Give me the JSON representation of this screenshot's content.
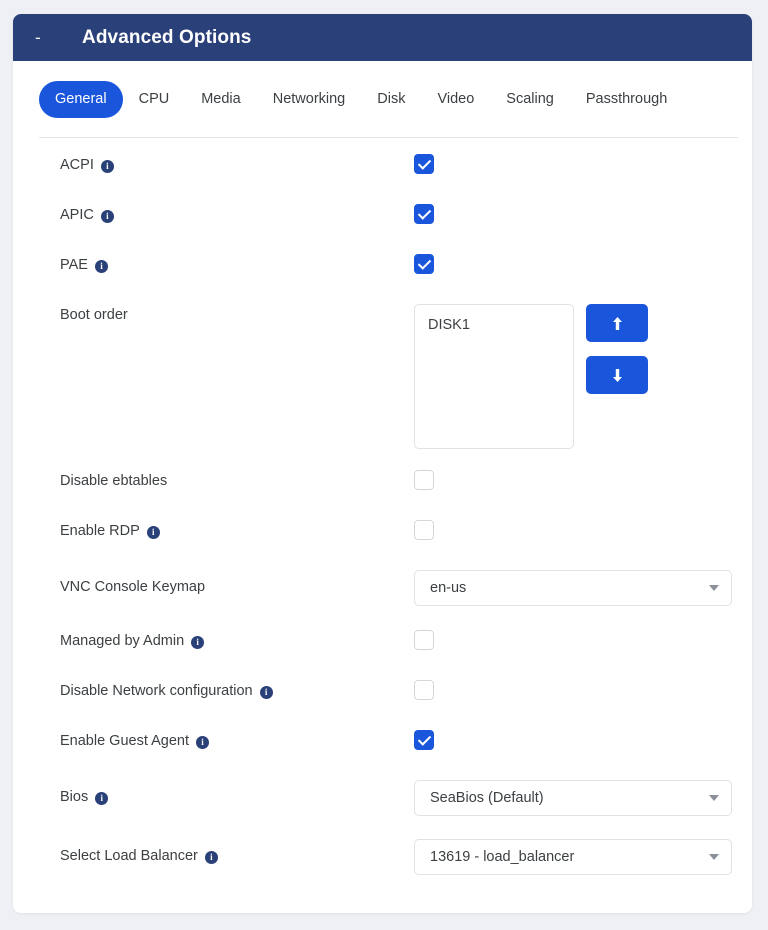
{
  "header": {
    "title": "Advanced Options",
    "collapse_toggle": "-"
  },
  "tabs": [
    {
      "label": "General",
      "active": true
    },
    {
      "label": "CPU",
      "active": false
    },
    {
      "label": "Media",
      "active": false
    },
    {
      "label": "Networking",
      "active": false
    },
    {
      "label": "Disk",
      "active": false
    },
    {
      "label": "Video",
      "active": false
    },
    {
      "label": "Scaling",
      "active": false
    },
    {
      "label": "Passthrough",
      "active": false
    }
  ],
  "form": {
    "acpi": {
      "label": "ACPI",
      "checked": true,
      "info": "i"
    },
    "apic": {
      "label": "APIC",
      "checked": true,
      "info": "i"
    },
    "pae": {
      "label": "PAE",
      "checked": true,
      "info": "i"
    },
    "boot_order": {
      "label": "Boot order",
      "items": [
        "DISK1"
      ],
      "move_up": "↑",
      "move_down": "↓"
    },
    "disable_ebtables": {
      "label": "Disable ebtables",
      "checked": false
    },
    "enable_rdp": {
      "label": "Enable RDP",
      "checked": false,
      "info": "i"
    },
    "vnc_console_keymap": {
      "label": "VNC Console Keymap",
      "value": "en-us"
    },
    "managed_by_admin": {
      "label": "Managed by Admin",
      "checked": false,
      "info": "i"
    },
    "disable_network_configuration": {
      "label": "Disable Network configuration",
      "checked": false,
      "info": "i"
    },
    "enable_guest_agent": {
      "label": "Enable Guest Agent",
      "checked": true,
      "info": "i"
    },
    "bios": {
      "label": "Bios",
      "value": "SeaBios (Default)",
      "info": "i"
    },
    "select_load_balancer": {
      "label": "Select Load Balancer",
      "value": "13619 - load_balancer",
      "info": "i"
    }
  },
  "colors": {
    "header_navy": "#2a4078",
    "accent_blue": "#1a56db",
    "page_background": "#eff0f5",
    "card_background": "#ffffff",
    "text": "#3c4043",
    "border": "#e0e2e7"
  }
}
